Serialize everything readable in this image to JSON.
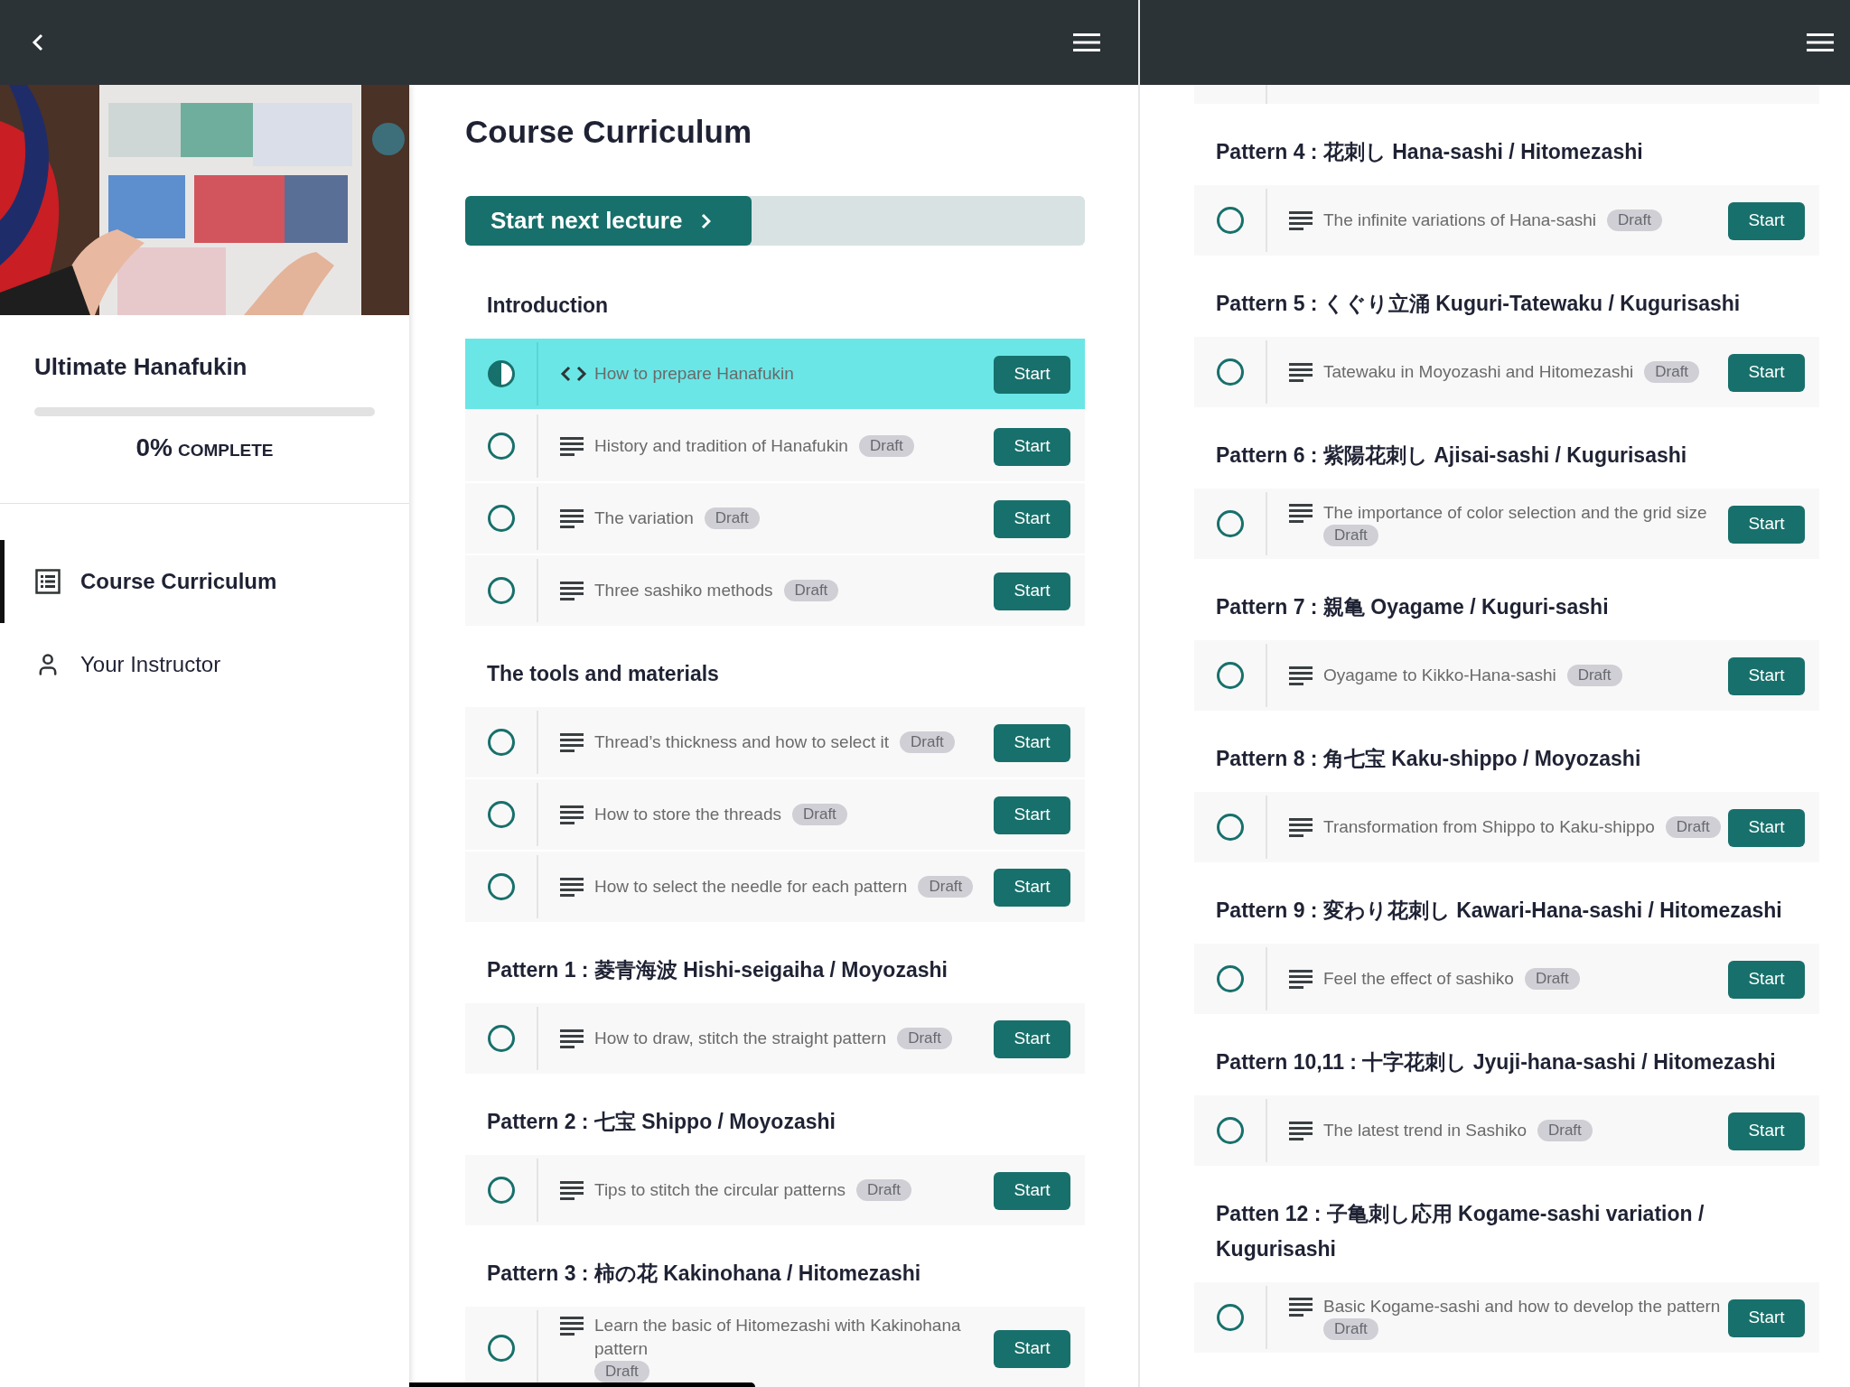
{
  "left_app": {
    "sidebar": {
      "course_title": "Ultimate Hanafukin",
      "progress": {
        "level": 0,
        "percent": "0%",
        "label": "COMPLETE"
      },
      "nav": [
        {
          "label": "Course Curriculum",
          "kind": "list",
          "selected": true
        },
        {
          "label": "Your Instructor",
          "kind": "person",
          "selected": false
        }
      ]
    },
    "main": {
      "title": "Course Curriculum",
      "start_button": "Start next lecture",
      "sections": [
        {
          "title": "Introduction",
          "lectures": [
            {
              "title": "How to prepare Hanafukin",
              "kind": "code",
              "started": true,
              "selected": true,
              "button": "Start"
            },
            {
              "title": "History and tradition of Hanafukin",
              "badge": "Draft",
              "kind": "text",
              "started": false,
              "selected": false,
              "button": "Start"
            },
            {
              "title": "The variation",
              "badge": "Draft",
              "kind": "text",
              "started": false,
              "selected": false,
              "button": "Start"
            },
            {
              "title": "Three sashiko methods",
              "badge": "Draft",
              "kind": "text",
              "started": false,
              "selected": false,
              "button": "Start"
            }
          ]
        },
        {
          "title": "The tools and materials",
          "lectures": [
            {
              "title": "Thread’s thickness and how to select it",
              "badge": "Draft",
              "kind": "text",
              "started": false,
              "selected": false,
              "button": "Start"
            },
            {
              "title": "How to store the threads",
              "badge": "Draft",
              "kind": "text",
              "started": false,
              "selected": false,
              "button": "Start"
            },
            {
              "title": "How to select the needle for each pattern",
              "badge": "Draft",
              "kind": "text",
              "started": false,
              "selected": false,
              "button": "Start"
            }
          ]
        },
        {
          "title": "Pattern 1 : 菱青海波 Hishi-seigaiha / Moyozashi",
          "lectures": [
            {
              "title": "How to draw, stitch the straight pattern",
              "badge": "Draft",
              "kind": "text",
              "started": false,
              "selected": false,
              "button": "Start"
            }
          ]
        },
        {
          "title": "Pattern 2 : 七宝 Shippo / Moyozashi",
          "lectures": [
            {
              "title": "Tips to stitch the circular patterns",
              "badge": "Draft",
              "kind": "text",
              "started": false,
              "selected": false,
              "button": "Start"
            }
          ]
        },
        {
          "title": "Pattern 3 : 柿の花 Kakinohana / Hitomezashi",
          "lectures": [
            {
              "title": "Learn the basic of Hitomezashi with Kakinohana pattern",
              "badge": "Draft",
              "kind": "text",
              "started": false,
              "selected": false,
              "button": "Start"
            }
          ]
        }
      ]
    }
  },
  "right_pane": {
    "sections": [
      {
        "title": "Pattern 4 : 花刺し Hana-sashi / Hitomezashi",
        "lectures": [
          {
            "title": "The infinite variations of Hana-sashi",
            "badge": "Draft",
            "kind": "text",
            "started": false,
            "selected": false,
            "button": "Start"
          }
        ]
      },
      {
        "title": "Pattern 5 : くぐり立涌 Kuguri-Tatewaku / Kugurisashi",
        "lectures": [
          {
            "title": "Tatewaku in Moyozashi and Hitomezashi",
            "badge": "Draft",
            "kind": "text",
            "started": false,
            "selected": false,
            "button": "Start"
          }
        ]
      },
      {
        "title": "Pattern 6 : 紫陽花刺し Ajisai-sashi / Kugurisashi",
        "lectures": [
          {
            "title": "The importance of color selection and the grid size",
            "badge": "Draft",
            "kind": "text",
            "started": false,
            "selected": false,
            "button": "Start"
          }
        ]
      },
      {
        "title": "Pattern 7 : 親亀 Oyagame / Kuguri-sashi",
        "lectures": [
          {
            "title": "Oyagame to Kikko-Hana-sashi",
            "badge": "Draft",
            "kind": "text",
            "started": false,
            "selected": false,
            "button": "Start"
          }
        ]
      },
      {
        "title": "Pattern 8 : 角七宝 Kaku-shippo / Moyozashi",
        "lectures": [
          {
            "title": "Transformation from Shippo to Kaku-shippo",
            "badge": "Draft",
            "kind": "text",
            "started": false,
            "selected": false,
            "button": "Start"
          }
        ]
      },
      {
        "title": "Pattern 9 : 変わり花刺し Kawari-Hana-sashi / Hitomezashi",
        "lectures": [
          {
            "title": "Feel the effect of sashiko",
            "badge": "Draft",
            "kind": "text",
            "started": false,
            "selected": false,
            "button": "Start"
          }
        ]
      },
      {
        "title": "Pattern 10,11 : 十字花刺し Jyuji-hana-sashi / Hitomezashi",
        "lectures": [
          {
            "title": "The latest trend in Sashiko",
            "badge": "Draft",
            "kind": "text",
            "started": false,
            "selected": false,
            "button": "Start"
          }
        ]
      },
      {
        "title": "Patten 12 : 子亀刺し応用 Kogame-sashi variation / Kugurisashi",
        "lectures": [
          {
            "title": "Basic Kogame-sashi and how to develop the pattern",
            "badge": "Draft",
            "kind": "text",
            "started": false,
            "selected": false,
            "button": "Start"
          }
        ]
      }
    ]
  }
}
